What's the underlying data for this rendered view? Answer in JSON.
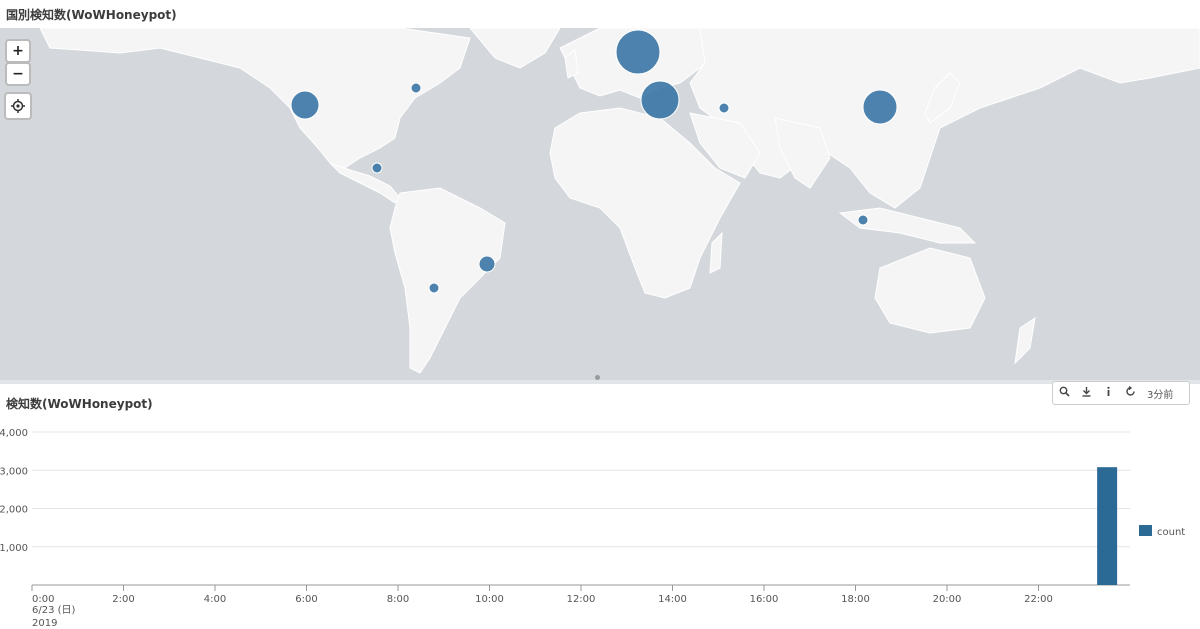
{
  "map_panel": {
    "title": "国別検知数(WoWHoneypot)",
    "zoom_in_label": "+",
    "zoom_out_label": "−",
    "markers": [
      {
        "name": "marker-europe",
        "size": "large"
      },
      {
        "name": "marker-turkey",
        "size": "large"
      },
      {
        "name": "marker-china",
        "size": "large"
      },
      {
        "name": "marker-us-west",
        "size": "medium"
      },
      {
        "name": "marker-us-east",
        "size": "small"
      },
      {
        "name": "marker-central-america",
        "size": "small"
      },
      {
        "name": "marker-iran",
        "size": "small"
      },
      {
        "name": "marker-indonesia",
        "size": "small"
      },
      {
        "name": "marker-brazil",
        "size": "small"
      },
      {
        "name": "marker-argentina",
        "size": "small"
      }
    ],
    "colors": {
      "ocean": "#d4d8dc",
      "land": "#f5f5f5",
      "marker": "#3a76a5"
    }
  },
  "chart_panel": {
    "title": "検知数(WoWHoneypot)",
    "toolbar": {
      "search_icon": "search-icon",
      "download_icon": "download-icon",
      "info_icon": "info-icon",
      "refresh_icon": "refresh-icon",
      "last_updated": "3分前"
    }
  },
  "chart_data": {
    "type": "bar",
    "title": "検知数(WoWHoneypot)",
    "x_tick_labels": [
      "0:00",
      "2:00",
      "4:00",
      "6:00",
      "8:00",
      "10:00",
      "12:00",
      "14:00",
      "16:00",
      "18:00",
      "20:00",
      "22:00"
    ],
    "x_date_label": "6/23 (日)",
    "x_year_label": "2019",
    "y_tick_labels": [
      "4,000",
      "3,000",
      "2,000",
      "1,000"
    ],
    "ylim": [
      0,
      4000
    ],
    "series": [
      {
        "name": "count",
        "color": "#2c6a96"
      }
    ],
    "bars": [
      {
        "hour": 23.5,
        "value": 3080
      }
    ],
    "legend": "right",
    "grid": true
  }
}
